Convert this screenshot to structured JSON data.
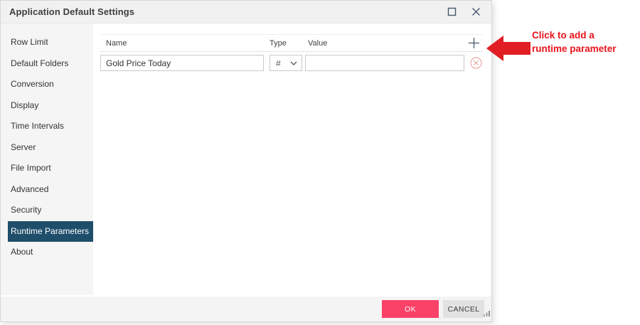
{
  "window": {
    "title": "Application Default Settings"
  },
  "sidebar": {
    "items": [
      {
        "label": "Row Limit",
        "active": false
      },
      {
        "label": "Default Folders",
        "active": false
      },
      {
        "label": "Conversion",
        "active": false
      },
      {
        "label": "Display",
        "active": false
      },
      {
        "label": "Time Intervals",
        "active": false
      },
      {
        "label": "Server",
        "active": false
      },
      {
        "label": "File Import",
        "active": false
      },
      {
        "label": "Advanced",
        "active": false
      },
      {
        "label": "Security",
        "active": false
      },
      {
        "label": "Runtime Parameters",
        "active": true
      },
      {
        "label": "About",
        "active": false
      }
    ]
  },
  "parameters": {
    "columns": {
      "name": "Name",
      "type": "Type",
      "value": "Value"
    },
    "rows": [
      {
        "name": "Gold Price Today",
        "type": "#",
        "value": ""
      }
    ],
    "icons": {
      "add": "plus-icon",
      "delete": "delete-circle-x-icon",
      "type_dropdown": "chevron-down-icon"
    }
  },
  "footer": {
    "ok_label": "OK",
    "cancel_label": "CANCEL"
  },
  "annotation": {
    "line1": "Click to add a",
    "line2": "runtime parameter"
  },
  "colors": {
    "active_item_bg": "#1f4e6b",
    "ok_button": "#fa4167",
    "annotation_red": "#e01e24",
    "icon_slate": "#46586c",
    "delete_icon": "#e9a8a3",
    "titlebar_bg": "#f1f1f2",
    "sidebar_bg": "#f5f5f6",
    "footer_bg": "#f4f4f4"
  }
}
